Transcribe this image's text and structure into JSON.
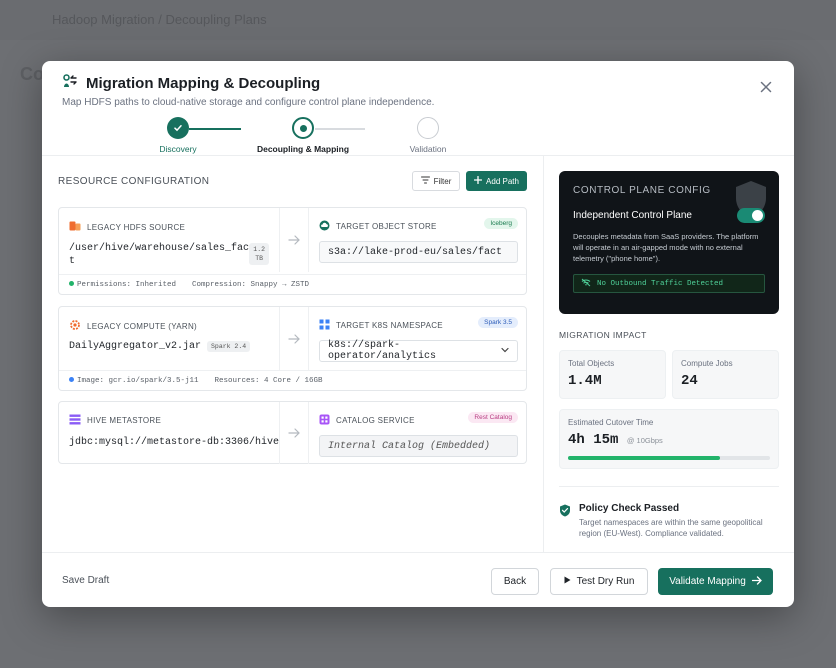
{
  "background": {
    "app_title": "Hadoop Migration / Decoupling Plans",
    "page_initial": "Co"
  },
  "modal": {
    "title": "Migration Mapping & Decoupling",
    "subtitle": "Map HDFS paths to cloud-native storage and configure control plane independence."
  },
  "steps": [
    {
      "label": "Discovery",
      "state": "done"
    },
    {
      "label": "Decoupling & Mapping",
      "state": "active"
    },
    {
      "label": "Validation",
      "state": "pending"
    }
  ],
  "resource": {
    "heading": "RESOURCE CONFIGURATION",
    "filter_label": "Filter",
    "add_label": "Add Path",
    "cards": [
      {
        "src_label": "LEGACY HDFS SOURCE",
        "src_value_1": "/user/hive/warehouse/sales_fac",
        "src_value_2": "t",
        "src_pill_1": "1.2",
        "src_pill_2": "TB",
        "tgt_label": "TARGET OBJECT STORE",
        "tgt_tag": "Iceberg",
        "tgt_value": "s3a://lake-prod-eu/sales/fact",
        "foot_1": "Permissions: Inherited",
        "foot_2": "Compression: Snappy → ZSTD"
      },
      {
        "src_label": "LEGACY COMPUTE (YARN)",
        "src_value": "DailyAggregator_v2.jar",
        "src_pill": "Spark 2.4",
        "tgt_label": "TARGET K8S NAMESPACE",
        "tgt_tag": "Spark 3.5",
        "tgt_value": "k8s://spark-operator/analytics",
        "foot_1": "Image: gcr.io/spark/3.5-j11",
        "foot_2": "Resources: 4 Core / 16GB"
      },
      {
        "src_label": "HIVE METASTORE",
        "src_value": "jdbc:mysql://metastore-db:3306/hive",
        "tgt_label": "CATALOG SERVICE",
        "tgt_tag": "Rest Catalog",
        "tgt_value": "Internal Catalog (Embedded)"
      }
    ]
  },
  "control_plane": {
    "title": "CONTROL PLANE CONFIG",
    "toggle_label": "Independent Control Plane",
    "toggle_on": true,
    "description": "Decouples metadata from SaaS providers. The platform will operate in an air-gapped mode with no external telemetry (\"phone home\").",
    "badge": "No Outbound Traffic Detected"
  },
  "impact": {
    "title": "MIGRATION IMPACT",
    "total_objects_label": "Total Objects",
    "total_objects_value": "1.4M",
    "compute_jobs_label": "Compute Jobs",
    "compute_jobs_value": "24",
    "cutover_label": "Estimated Cutover Time",
    "cutover_value": "4h 15m",
    "cutover_rate": "@ 10Gbps",
    "cutover_progress": 0.75
  },
  "policy": {
    "title": "Policy Check Passed",
    "description": "Target namespaces are within the same geopolitical region (EU-West). Compliance validated."
  },
  "footer": {
    "save_draft": "Save Draft",
    "back": "Back",
    "dry_run": "Test Dry Run",
    "validate": "Validate Mapping"
  },
  "colors": {
    "primary": "#17705e",
    "success": "#22b36a",
    "dark_panel": "#101418"
  }
}
